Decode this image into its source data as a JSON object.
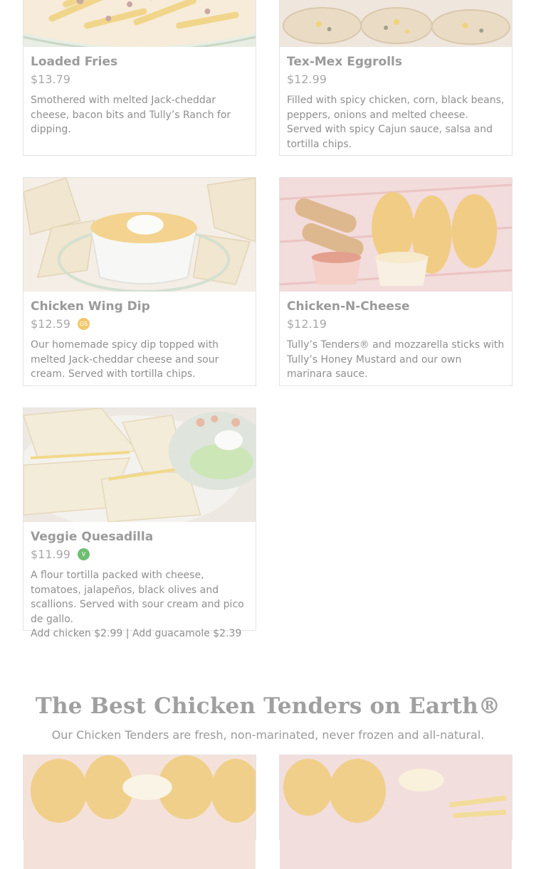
{
  "menu_items": [
    {
      "name": "Loaded Fries",
      "price": "$13.79",
      "description": "Smothered with melted Jack-cheddar cheese, bacon bits and Tully’s Ranch for dipping."
    },
    {
      "name": "Tex-Mex Eggrolls",
      "price": "$12.99",
      "description": "Filled with spicy chicken, corn, black beans, peppers, onions and melted cheese. Served with spicy Cajun sauce, salsa and tortilla chips."
    },
    {
      "name": "Chicken Wing Dip",
      "price": "$12.59",
      "badge": "GS",
      "badge_color": "#f2c86b",
      "description": "Our homemade spicy dip topped with melted Jack-cheddar cheese and sour cream. Served with tortilla chips."
    },
    {
      "name": "Chicken-N-Cheese",
      "price": "$12.19",
      "description": "Tully’s Tenders® and mozzarella sticks with Tully’s Honey Mustard and our own marinara sauce."
    },
    {
      "name": "Veggie Quesadilla",
      "price": "$11.99",
      "badge": "V",
      "badge_color": "#6fbd72",
      "description": "A flour tortilla packed with cheese, tomatoes, jalapeños, black olives and scallions. Served with sour cream and pico de gallo.",
      "extra": "Add chicken $2.99 | Add guacamole $2.39"
    }
  ],
  "section": {
    "title": "The Best Chicken Tenders on Earth®",
    "subtitle": "Our Chicken Tenders are fresh, non-marinated, never frozen and all-natural."
  }
}
